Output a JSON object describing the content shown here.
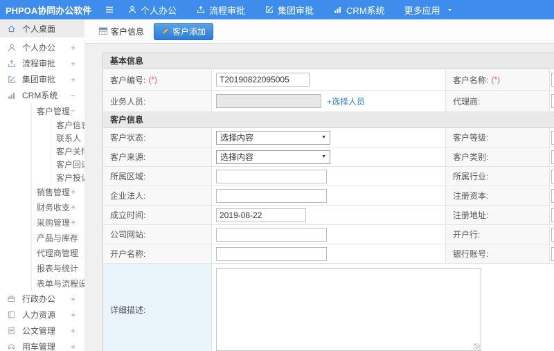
{
  "topbar": {
    "brand": "PHPOA协同办公软件",
    "items": [
      {
        "label": "个人办公",
        "icon": "user-icon"
      },
      {
        "label": "流程审批",
        "icon": "flow-icon"
      },
      {
        "label": "集团审批",
        "icon": "edit-icon"
      },
      {
        "label": "CRM系统",
        "icon": "chart-icon"
      },
      {
        "label": "更多应用",
        "icon": "",
        "caret": true
      }
    ]
  },
  "sidebar": {
    "items": [
      {
        "label": "个人桌面",
        "icon": "home-icon",
        "active": true,
        "expand": ""
      },
      {
        "label": "个人办公",
        "icon": "user-icon",
        "expand": "+"
      },
      {
        "label": "流程审批",
        "icon": "flow-icon",
        "expand": "+"
      },
      {
        "label": "集团审批",
        "icon": "edit-icon",
        "expand": "+"
      },
      {
        "label": "CRM系统",
        "icon": "chart-icon",
        "expand": "−",
        "children": [
          {
            "label": "客户管理",
            "expand": "−",
            "children": [
              {
                "label": "客户信息"
              },
              {
                "label": "联系人"
              },
              {
                "label": "客户关怀"
              },
              {
                "label": "客户回访"
              },
              {
                "label": "客户投诉"
              }
            ]
          },
          {
            "label": "销售管理",
            "expand": "+"
          },
          {
            "label": "财务收支",
            "expand": "+"
          },
          {
            "label": "采购管理",
            "expand": "+"
          },
          {
            "label": "产品与库存",
            "expand": "+"
          },
          {
            "label": "代理商管理",
            "expand": "+"
          },
          {
            "label": "报表与统计",
            "expand": ""
          },
          {
            "label": "表单与流程设置",
            "expand": "+"
          }
        ]
      },
      {
        "label": "行政办公",
        "icon": "briefcase-icon",
        "expand": "+"
      },
      {
        "label": "人力资源",
        "icon": "book-icon",
        "expand": "+"
      },
      {
        "label": "公文管理",
        "icon": "document-icon",
        "expand": "+"
      },
      {
        "label": "用车管理",
        "icon": "car-icon",
        "expand": "+"
      }
    ]
  },
  "tabbar": {
    "tabs": [
      {
        "label": "客户信息",
        "icon": "table-icon",
        "active": false
      },
      {
        "label": "客户添加",
        "icon": "add-pencil-icon",
        "active": true
      }
    ]
  },
  "form": {
    "required_mark": "(*)",
    "sections": [
      {
        "title": "基本信息",
        "rows": [
          {
            "left": {
              "label": "客户编号:",
              "required": true,
              "field": {
                "type": "text",
                "kind": "code",
                "value": "T20190822095005"
              }
            },
            "right": {
              "label": "客户名称:",
              "required": true,
              "field": {
                "type": "clipped"
              }
            }
          },
          {
            "left": {
              "label": "业务人员:",
              "field": {
                "type": "picker",
                "value": "",
                "link": "+选择人员"
              }
            },
            "right": {
              "label": "代理商:",
              "field": {
                "type": "clipped"
              }
            }
          }
        ]
      },
      {
        "title": "客户信息",
        "rows": [
          {
            "left": {
              "label": "客户状态:",
              "field": {
                "type": "select",
                "value": "选择内容"
              }
            },
            "right": {
              "label": "客户等级:",
              "field": {
                "type": "clipped"
              }
            }
          },
          {
            "left": {
              "label": "客户来源:",
              "field": {
                "type": "select",
                "value": "选择内容"
              }
            },
            "right": {
              "label": "客户类别:",
              "field": {
                "type": "clipped"
              }
            }
          },
          {
            "left": {
              "label": "所属区域:",
              "field": {
                "type": "text",
                "kind": "text",
                "value": ""
              }
            },
            "right": {
              "label": "所属行业:",
              "field": {
                "type": "clipped"
              }
            }
          },
          {
            "left": {
              "label": "企业法人:",
              "field": {
                "type": "text",
                "kind": "text",
                "value": ""
              }
            },
            "right": {
              "label": "注册资本:",
              "field": {
                "type": "clipped"
              }
            }
          },
          {
            "left": {
              "label": "成立时间:",
              "field": {
                "type": "text",
                "kind": "date",
                "value": "2019-08-22"
              }
            },
            "right": {
              "label": "注册地址:",
              "field": {
                "type": "clipped"
              }
            }
          },
          {
            "left": {
              "label": "公司网站:",
              "field": {
                "type": "text",
                "kind": "text",
                "value": ""
              }
            },
            "right": {
              "label": "开户行:",
              "field": {
                "type": "clipped"
              }
            }
          },
          {
            "left": {
              "label": "开户名称:",
              "field": {
                "type": "text",
                "kind": "text",
                "value": ""
              }
            },
            "right": {
              "label": "银行账号:",
              "field": {
                "type": "clipped"
              }
            }
          },
          {
            "left": {
              "label": "详细描述:",
              "field": {
                "type": "textarea",
                "value": ""
              }
            },
            "right": null
          }
        ]
      }
    ]
  },
  "colors": {
    "topbar": "#3e8ceb",
    "active_tab": "#2c7ed6",
    "link": "#2f7fd1",
    "required": "#e05a5a",
    "detail_label_bg": "#eaf4fb"
  }
}
